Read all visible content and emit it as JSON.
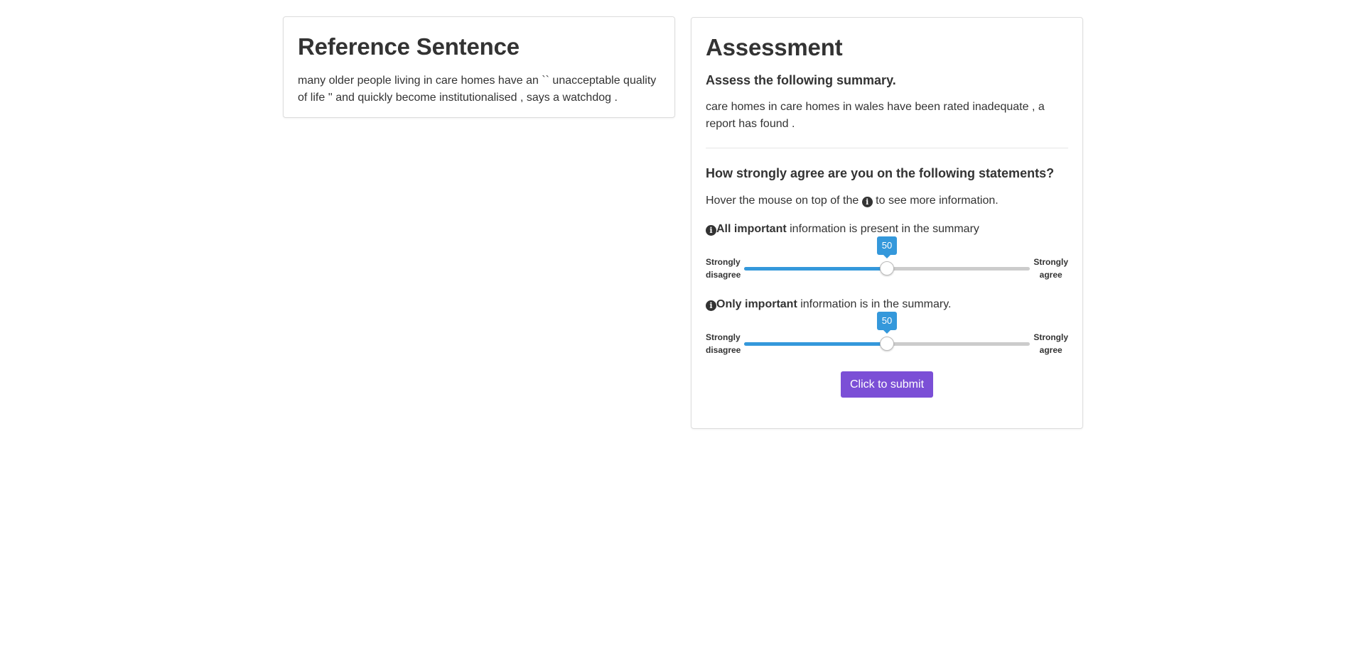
{
  "reference": {
    "title": "Reference Sentence",
    "text": "many older people living in care homes have an `` unacceptable quality of life '' and quickly become institutionalised , says a watchdog ."
  },
  "assessment": {
    "title": "Assessment",
    "subhead": "Assess the following summary.",
    "summary": "care homes in care homes in wales have been rated inadequate , a report has found .",
    "question": "How strongly agree are you on the following statements?",
    "hover_prefix": "Hover the mouse on top of the",
    "hover_suffix": "to see more information.",
    "info_glyph": "i",
    "statements": [
      {
        "bold": "All important",
        "rest": " information is present in the summary",
        "value": 50,
        "value_label": "50",
        "left_label_1": "Strongly",
        "left_label_2": "disagree",
        "right_label_1": "Strongly",
        "right_label_2": "agree"
      },
      {
        "bold": "Only important",
        "rest": " information is in the summary.",
        "value": 50,
        "value_label": "50",
        "left_label_1": "Strongly",
        "left_label_2": "disagree",
        "right_label_1": "Strongly",
        "right_label_2": "agree"
      }
    ],
    "submit_label": "Click to submit"
  },
  "colors": {
    "slider_fill": "#3498db",
    "slider_track": "#cccccc",
    "submit_button": "#7b4fd6"
  }
}
